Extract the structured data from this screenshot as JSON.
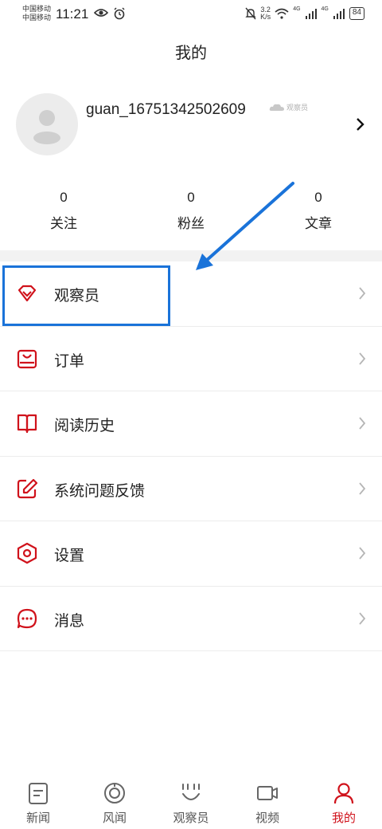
{
  "status_bar": {
    "carrier1": "中国移动",
    "carrier2": "中国移动",
    "time": "11:21",
    "speed_value": "3.2",
    "speed_unit": "K/s",
    "net1": "4G",
    "net2": "4G",
    "battery": "84"
  },
  "header": {
    "title": "我的"
  },
  "profile": {
    "username": "guan_16751342502609",
    "badge": "观察员"
  },
  "stats": [
    {
      "value": "0",
      "label": "关注"
    },
    {
      "value": "0",
      "label": "粉丝"
    },
    {
      "value": "0",
      "label": "文章"
    }
  ],
  "menu": [
    {
      "label": "观察员",
      "icon": "gem-icon"
    },
    {
      "label": "订单",
      "icon": "bag-icon"
    },
    {
      "label": "阅读历史",
      "icon": "book-icon"
    },
    {
      "label": "系统问题反馈",
      "icon": "edit-icon"
    },
    {
      "label": "设置",
      "icon": "hexagon-icon"
    },
    {
      "label": "消息",
      "icon": "chat-icon"
    }
  ],
  "bottom_nav": [
    {
      "label": "新闻",
      "icon": "news-icon",
      "active": false
    },
    {
      "label": "风闻",
      "icon": "circle-target-icon",
      "active": false
    },
    {
      "label": "观察员",
      "icon": "observer-face-icon",
      "active": false
    },
    {
      "label": "视频",
      "icon": "video-camera-icon",
      "active": false
    },
    {
      "label": "我的",
      "icon": "person-icon",
      "active": true
    }
  ],
  "colors": {
    "accent_red": "#d0121b",
    "annotation_blue": "#1a73d9"
  }
}
